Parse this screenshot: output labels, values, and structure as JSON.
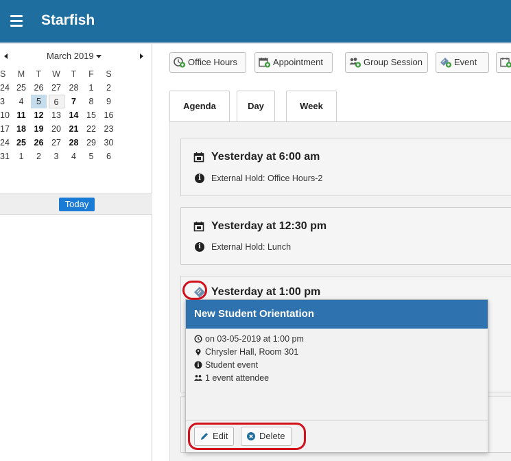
{
  "app": {
    "title": "Starfish"
  },
  "calendar": {
    "month_label": "March 2019",
    "weekdays": [
      "S",
      "M",
      "T",
      "W",
      "T",
      "F",
      "S"
    ],
    "weeks": [
      [
        "24",
        "25",
        "26",
        "27",
        "28",
        "1",
        "2"
      ],
      [
        "3",
        "4",
        "5",
        "6",
        "7",
        "8",
        "9"
      ],
      [
        "10",
        "11",
        "12",
        "13",
        "14",
        "15",
        "16"
      ],
      [
        "17",
        "18",
        "19",
        "20",
        "21",
        "22",
        "23"
      ],
      [
        "24",
        "25",
        "26",
        "27",
        "28",
        "29",
        "30"
      ],
      [
        "31",
        "1",
        "2",
        "3",
        "4",
        "5",
        "6"
      ]
    ],
    "selected_day": "5",
    "current_day": "6",
    "today_label": "Today"
  },
  "toolbar": {
    "office_hours": "Office Hours",
    "appointment": "Appointment",
    "group_session": "Group Session",
    "event": "Event"
  },
  "tabs": {
    "agenda": "Agenda",
    "day": "Day",
    "week": "Week"
  },
  "agenda": [
    {
      "time": "Yesterday at 6:00 am",
      "detail": "External Hold: Office Hours-2"
    },
    {
      "time": "Yesterday at 12:30 pm",
      "detail": "External Hold: Lunch"
    },
    {
      "time": "Yesterday at 1:00 pm"
    }
  ],
  "popover": {
    "title": "New Student Orientation",
    "when": "on 03-05-2019 at 1:00 pm",
    "location": "Chrysler Hall, Room 301",
    "type": "Student event",
    "attendees": "1 event attendee",
    "edit_label": "Edit",
    "delete_label": "Delete"
  },
  "colors": {
    "header": "#1f6ea0",
    "popover_header": "#2e73b0",
    "today_button": "#1a7bd6",
    "selected_day": "#c5dcec",
    "highlight_ring": "#d0111b"
  }
}
